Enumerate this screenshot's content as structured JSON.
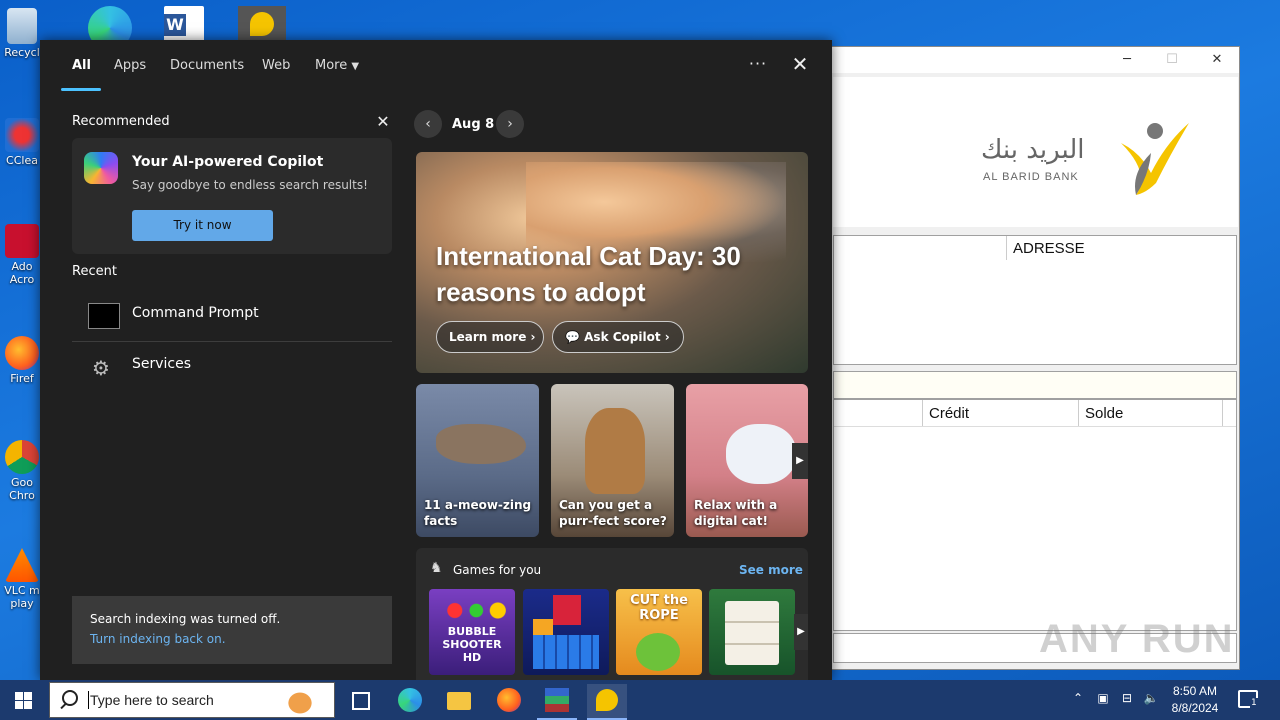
{
  "desktop": {
    "icons": [
      "Recycl",
      "CClea",
      "Ado Acro",
      "Firef",
      "Goo Chro",
      "VLC m play"
    ]
  },
  "app_window": {
    "bank_name_arabic": "البريد بنك",
    "bank_name": "AL BARID BANK",
    "col_adresse": "ADRESSE",
    "col_credit": "Crédit",
    "col_solde": "Solde"
  },
  "search": {
    "tabs": [
      "All",
      "Apps",
      "Documents",
      "Web",
      "More"
    ],
    "recommended_label": "Recommended",
    "copilot_title": "Your AI-powered Copilot",
    "copilot_subtitle": "Say goodbye to endless search results!",
    "copilot_button": "Try it now",
    "recent_label": "Recent",
    "recent": [
      "Command Prompt",
      "Services"
    ],
    "notice_title": "Search indexing was turned off.",
    "notice_link": "Turn indexing back on.",
    "date": "Aug 8",
    "hero_title": "International Cat Day: 30 reasons to adopt",
    "hero_learn": "Learn more",
    "hero_copilot": "Ask Copilot",
    "tiles": [
      "11 a-meow-zing facts",
      "Can you get a purr-fect score?",
      "Relax with a digital cat!"
    ],
    "games_label": "Games for you",
    "see_more": "See more",
    "games": [
      "BUBBLE SHOOTER HD",
      "Block puzzle",
      "CUT the ROPE",
      "Mahjong"
    ]
  },
  "taskbar": {
    "search_placeholder": "Type here to search",
    "time": "8:50 AM",
    "date": "8/8/2024",
    "notification_count": "1"
  },
  "watermark": "ANY RUN",
  "colors": {
    "accent": "#4cc2ff",
    "button_blue": "#62a8e8",
    "flyout_bg": "#202020"
  }
}
